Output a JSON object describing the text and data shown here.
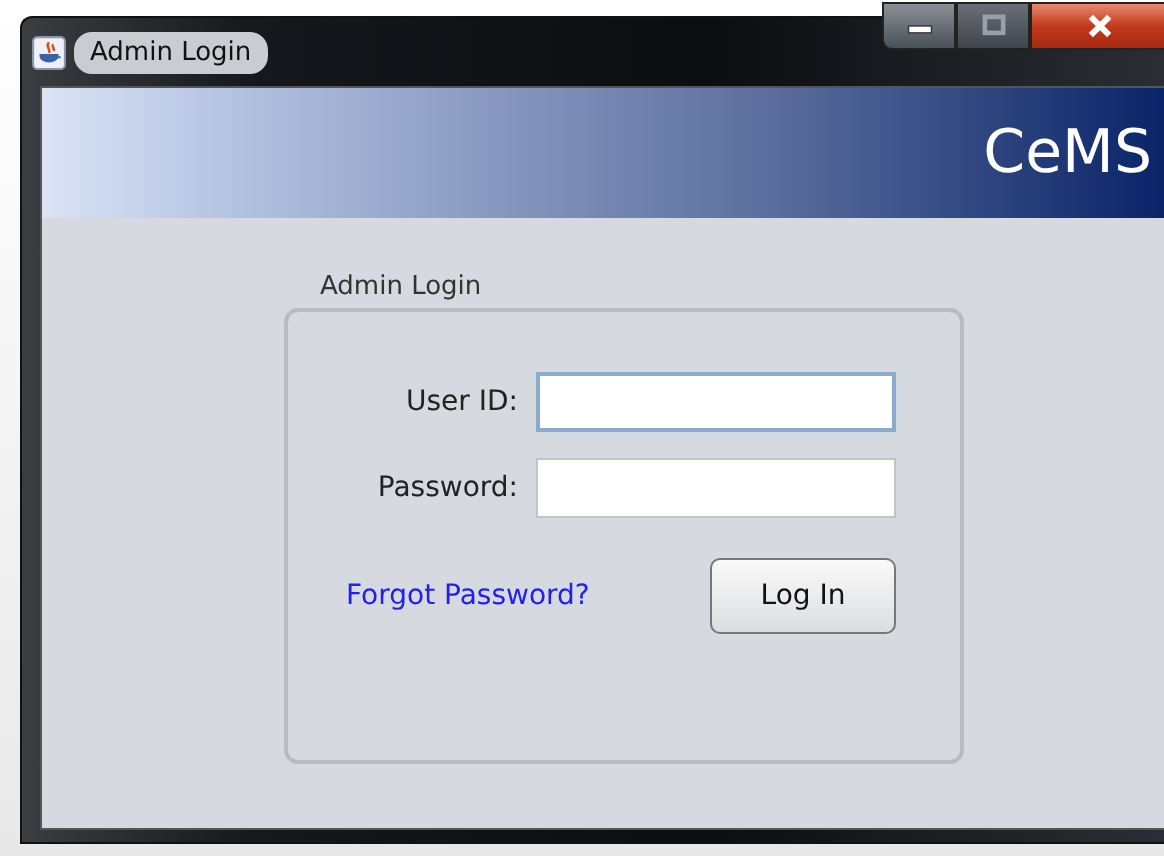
{
  "window": {
    "title": "Admin Login",
    "controls": [
      {
        "kind": "minimize",
        "disabled": false
      },
      {
        "kind": "maximize",
        "disabled": true
      },
      {
        "kind": "close",
        "disabled": false
      }
    ]
  },
  "banner": {
    "title": "CeMS"
  },
  "login_group": {
    "title": "Admin Login",
    "fields": [
      {
        "label": "User ID:",
        "focused": true
      },
      {
        "label": "Password:",
        "focused": false
      }
    ],
    "link": "Forgot Password?",
    "button": "Log In"
  }
}
